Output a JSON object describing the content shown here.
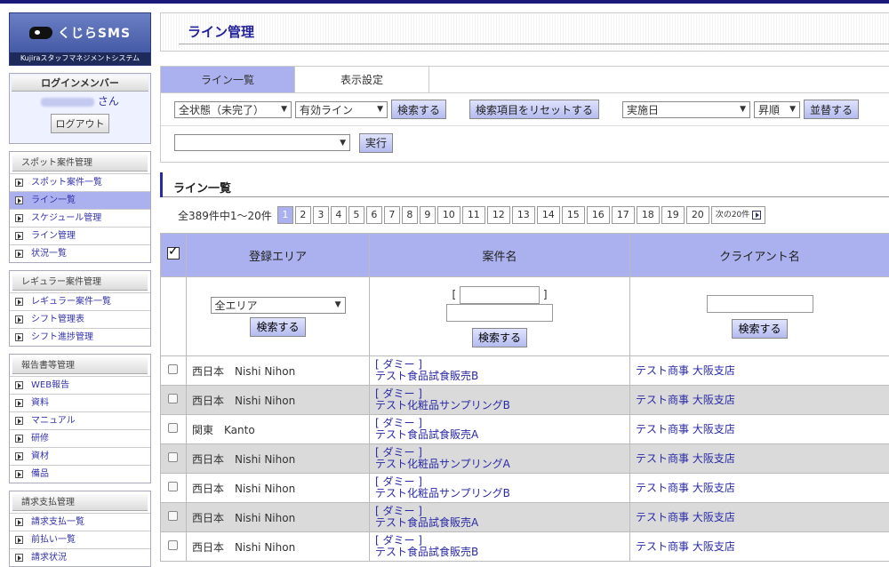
{
  "sidebar": {
    "logo_text": "くじらSMS",
    "logo_sub": "Kujiraスタッフマネジメントシステム",
    "login_title": "ログインメンバー",
    "login_suffix": "さん",
    "logout_label": "ログアウト",
    "groups": [
      {
        "title": "スポット案件管理",
        "items": [
          "スポット案件一覧",
          "ライン一覧",
          "スケジュール管理",
          "ライン管理",
          "状況一覧"
        ]
      },
      {
        "title": "レギュラー案件管理",
        "items": [
          "レギュラー案件一覧",
          "シフト管理表",
          "シフト進捗管理"
        ]
      },
      {
        "title": "報告書等管理",
        "items": [
          "WEB報告",
          "資料",
          "マニュアル",
          "研修",
          "資材",
          "備品"
        ]
      },
      {
        "title": "請求支払管理",
        "items": [
          "請求支払一覧",
          "前払い一覧",
          "請求状況"
        ]
      }
    ]
  },
  "header": {
    "title": "ライン管理"
  },
  "tabs": [
    "ライン一覧",
    "表示設定"
  ],
  "filters": {
    "status": "全状態（未完了）",
    "line": "有効ライン",
    "search_label": "検索する",
    "reset_label": "検索項目をリセットする",
    "sort_field": "実施日",
    "sort_order": "昇順",
    "sort_label": "並替する",
    "action_select": "",
    "execute_label": "実行"
  },
  "list": {
    "title": "ライン一覧",
    "total": "全389件中1～20件",
    "pages": [
      "1",
      "2",
      "3",
      "4",
      "5",
      "6",
      "7",
      "8",
      "9",
      "10",
      "11",
      "12",
      "13",
      "14",
      "15",
      "16",
      "17",
      "18",
      "19",
      "20"
    ],
    "next_label": "次の20件",
    "columns": [
      "登録エリア",
      "案件名",
      "クライアント名"
    ],
    "area_filter": "全エリア",
    "bracket_open": "[",
    "bracket_close": "]",
    "filter_search": "検索する",
    "rows": [
      {
        "area": "西日本　Nishi Nihon",
        "tag": "[ ダミー ]",
        "project": "テスト食品試食販売B",
        "client": "テスト商事 大阪支店"
      },
      {
        "area": "西日本　Nishi Nihon",
        "tag": "[ ダミー ]",
        "project": "テスト化粧品サンプリングB",
        "client": "テスト商事 大阪支店"
      },
      {
        "area": "関東　Kanto",
        "tag": "[ ダミー ]",
        "project": "テスト食品試食販売A",
        "client": "テスト商事 大阪支店"
      },
      {
        "area": "西日本　Nishi Nihon",
        "tag": "[ ダミー ]",
        "project": "テスト化粧品サンプリングA",
        "client": "テスト商事 大阪支店"
      },
      {
        "area": "西日本　Nishi Nihon",
        "tag": "[ ダミー ]",
        "project": "テスト化粧品サンプリングB",
        "client": "テスト商事 大阪支店"
      },
      {
        "area": "西日本　Nishi Nihon",
        "tag": "[ ダミー ]",
        "project": "テスト食品試食販売A",
        "client": "テスト商事 大阪支店"
      },
      {
        "area": "西日本　Nishi Nihon",
        "tag": "[ ダミー ]",
        "project": "テスト食品試食販売B",
        "client": "テスト商事 大阪支店"
      }
    ]
  }
}
